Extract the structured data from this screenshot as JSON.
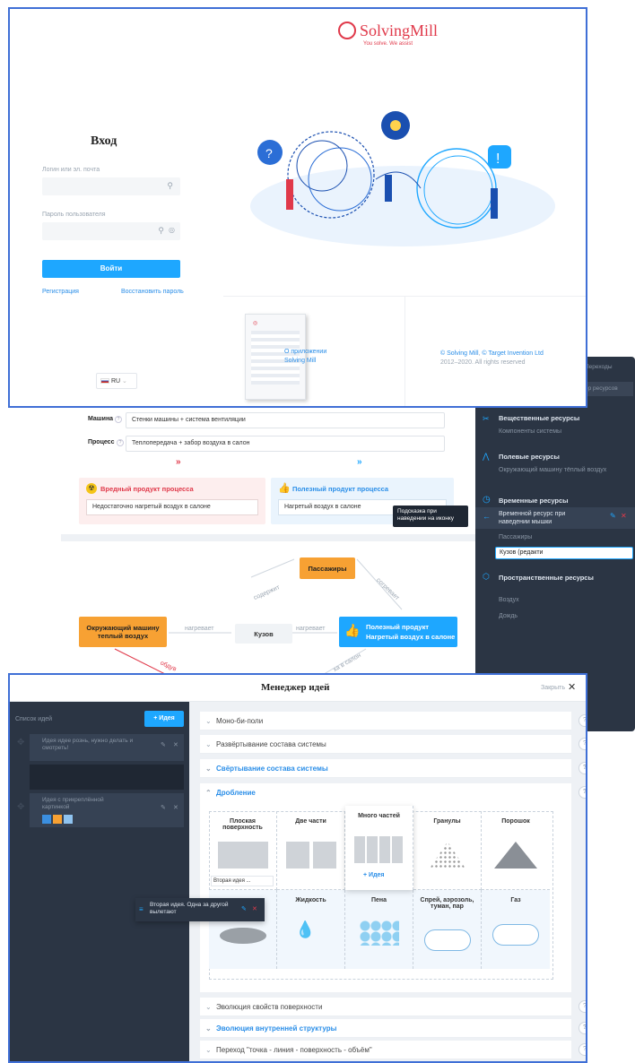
{
  "login": {
    "brand": "SolvingMill",
    "tagline": "You solve. We assist",
    "title": "Вход",
    "login_label": "Логин или эл. почта",
    "password_label": "Пароль пользователя",
    "submit": "Войти",
    "register": "Регистрация",
    "restore": "Восстановить пароль",
    "lang": "RU",
    "about": "О приложении\nSolving Mill",
    "copyright_brand": "© Solving Mill",
    "copyright_sep": ", ",
    "copyright_partner": "© Target Invention Ltd",
    "copyright_years": "2012–2020. All rights reserved"
  },
  "process": {
    "machine_label": "Машина",
    "machine_value": "Стенки машины + система вентиляции",
    "process_label": "Процесс",
    "process_value": "Теплопередача + забор воздуха в салон",
    "harmful_title": "Вредный продукт процесса",
    "harmful_value": "Недостаточно нагретый воздух в салоне",
    "useful_title": "Полезный продукт процесса",
    "useful_value": "Нагретый воздух в салоне",
    "tooltip": "Подсказка при наведении на иконку"
  },
  "graph": {
    "node_passengers": "Пассажиры",
    "node_air": "Окружающий машину теплый воздух",
    "node_body": "Кузов",
    "node_useful_line1": "Полезный продукт",
    "node_useful_line2": "Нагретый воздух в салоне",
    "edge_heats1": "нагревает",
    "edge_heats2": "нагревает",
    "edge_contains": "содержит",
    "edge_warms": "согревает",
    "edge_cut1": "обдув",
    "edge_cut2": "ха в салон"
  },
  "resources": {
    "header": "Переходы",
    "search": "ер ресурсов",
    "substance_title": "Вещественные ресурсы",
    "substance_item": "Компоненты системы",
    "field_title": "Полевые ресурсы",
    "field_item": "Окружающий машину тёплый воздух",
    "time_title": "Временные ресурсы",
    "time_item1": "Временной ресурс при наведении мышки",
    "time_item2": "Пассажиры",
    "time_item3": "Кузов (редакти",
    "space_title": "Пространственные ресурсы",
    "space_item1": "Воздух",
    "space_item2": "Дождь"
  },
  "ideas": {
    "title": "Менеджер идей",
    "close": "Закрыть",
    "list_title": "Список идей",
    "add_button": "+ Идея",
    "idea1": "Идея идее рознь, нужно делать и смотреть!",
    "idea2": "Идея с прикреплённой картинкой",
    "drag_text": "Вторая идея. Одна за другой вылетают",
    "sections": [
      {
        "label": "Моно-би-поли",
        "active": false
      },
      {
        "label": "Развёртывание состава системы",
        "active": false
      },
      {
        "label": "Свёртывание состава системы",
        "active": true
      },
      {
        "label": "Дробление",
        "active": true
      }
    ],
    "grid_top": [
      "Плоская поверхность",
      "Две части",
      "Много частей",
      "Гранулы",
      "Порошок"
    ],
    "grid_bottom": [
      "",
      "Жидкость",
      "Пена",
      "Спрей, аэрозоль, туман, пар",
      "Газ"
    ],
    "cell_note": "Вторая идея ...",
    "cell_add": "+ Идея",
    "sections_after": [
      {
        "label": "Эволюция свойств поверхности",
        "active": false
      },
      {
        "label": "Эволюция внутренней структуры",
        "active": true
      },
      {
        "label": "Переход \"точка - линия - поверхность - объём\"",
        "active": false
      }
    ]
  }
}
